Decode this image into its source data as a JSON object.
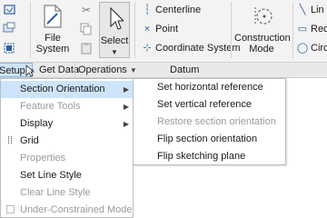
{
  "ribbon": {
    "file_system": {
      "line1": "File",
      "line2": "System"
    },
    "select": {
      "label": "Select"
    },
    "datum_items": [
      {
        "label": "Centerline",
        "icon": "centerline-icon"
      },
      {
        "label": "Point",
        "icon": "point-icon"
      },
      {
        "label": "Coordinate System",
        "icon": "coordinate-system-icon"
      }
    ],
    "construction_mode": {
      "line1": "Construction",
      "line2": "Mode"
    },
    "right_items": [
      "Lin",
      "Rec",
      "Circ"
    ]
  },
  "group_bar": {
    "setup": "Setup",
    "get_data": "Get Data",
    "operations": "Operations",
    "datum": "Datum"
  },
  "setup_menu": {
    "items": [
      {
        "label": "Section Orientation",
        "disabled": false,
        "submenu": true,
        "highlighted": true
      },
      {
        "label": "Feature Tools",
        "disabled": true,
        "submenu": true
      },
      {
        "label": "Display",
        "disabled": false,
        "submenu": true
      },
      {
        "label": "Grid",
        "disabled": false,
        "icon": "grid-icon"
      },
      {
        "label": "Properties",
        "disabled": true
      },
      {
        "label": "Set Line Style",
        "disabled": false
      },
      {
        "label": "Clear Line Style",
        "disabled": true
      },
      {
        "label": "Under-Constrained Mode",
        "disabled": true,
        "icon": "checkbox-icon"
      }
    ]
  },
  "section_orientation_submenu": {
    "items": [
      {
        "label": "Set horizontal reference",
        "disabled": false
      },
      {
        "label": "Set vertical reference",
        "disabled": false
      },
      {
        "label": "Restore section orientation",
        "disabled": true
      },
      {
        "label": "Flip section orientation",
        "disabled": false
      },
      {
        "label": "Flip sketching plane",
        "disabled": false
      }
    ]
  },
  "colors": {
    "highlight": "#cde4fa",
    "accent": "#2c5fa0",
    "disabled_text": "#9a9a9a"
  }
}
